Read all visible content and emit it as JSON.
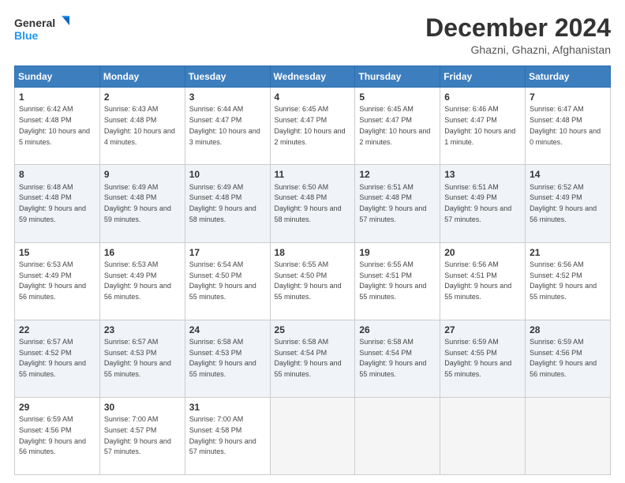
{
  "header": {
    "logo_line1": "General",
    "logo_line2": "Blue",
    "month": "December 2024",
    "location": "Ghazni, Ghazni, Afghanistan"
  },
  "days_of_week": [
    "Sunday",
    "Monday",
    "Tuesday",
    "Wednesday",
    "Thursday",
    "Friday",
    "Saturday"
  ],
  "weeks": [
    [
      {
        "day": "1",
        "sunrise": "6:42 AM",
        "sunset": "4:48 PM",
        "daylight": "10 hours and 5 minutes."
      },
      {
        "day": "2",
        "sunrise": "6:43 AM",
        "sunset": "4:48 PM",
        "daylight": "10 hours and 4 minutes."
      },
      {
        "day": "3",
        "sunrise": "6:44 AM",
        "sunset": "4:47 PM",
        "daylight": "10 hours and 3 minutes."
      },
      {
        "day": "4",
        "sunrise": "6:45 AM",
        "sunset": "4:47 PM",
        "daylight": "10 hours and 2 minutes."
      },
      {
        "day": "5",
        "sunrise": "6:45 AM",
        "sunset": "4:47 PM",
        "daylight": "10 hours and 2 minutes."
      },
      {
        "day": "6",
        "sunrise": "6:46 AM",
        "sunset": "4:47 PM",
        "daylight": "10 hours and 1 minute."
      },
      {
        "day": "7",
        "sunrise": "6:47 AM",
        "sunset": "4:48 PM",
        "daylight": "10 hours and 0 minutes."
      }
    ],
    [
      {
        "day": "8",
        "sunrise": "6:48 AM",
        "sunset": "4:48 PM",
        "daylight": "9 hours and 59 minutes."
      },
      {
        "day": "9",
        "sunrise": "6:49 AM",
        "sunset": "4:48 PM",
        "daylight": "9 hours and 59 minutes."
      },
      {
        "day": "10",
        "sunrise": "6:49 AM",
        "sunset": "4:48 PM",
        "daylight": "9 hours and 58 minutes."
      },
      {
        "day": "11",
        "sunrise": "6:50 AM",
        "sunset": "4:48 PM",
        "daylight": "9 hours and 58 minutes."
      },
      {
        "day": "12",
        "sunrise": "6:51 AM",
        "sunset": "4:48 PM",
        "daylight": "9 hours and 57 minutes."
      },
      {
        "day": "13",
        "sunrise": "6:51 AM",
        "sunset": "4:49 PM",
        "daylight": "9 hours and 57 minutes."
      },
      {
        "day": "14",
        "sunrise": "6:52 AM",
        "sunset": "4:49 PM",
        "daylight": "9 hours and 56 minutes."
      }
    ],
    [
      {
        "day": "15",
        "sunrise": "6:53 AM",
        "sunset": "4:49 PM",
        "daylight": "9 hours and 56 minutes."
      },
      {
        "day": "16",
        "sunrise": "6:53 AM",
        "sunset": "4:49 PM",
        "daylight": "9 hours and 56 minutes."
      },
      {
        "day": "17",
        "sunrise": "6:54 AM",
        "sunset": "4:50 PM",
        "daylight": "9 hours and 55 minutes."
      },
      {
        "day": "18",
        "sunrise": "6:55 AM",
        "sunset": "4:50 PM",
        "daylight": "9 hours and 55 minutes."
      },
      {
        "day": "19",
        "sunrise": "6:55 AM",
        "sunset": "4:51 PM",
        "daylight": "9 hours and 55 minutes."
      },
      {
        "day": "20",
        "sunrise": "6:56 AM",
        "sunset": "4:51 PM",
        "daylight": "9 hours and 55 minutes."
      },
      {
        "day": "21",
        "sunrise": "6:56 AM",
        "sunset": "4:52 PM",
        "daylight": "9 hours and 55 minutes."
      }
    ],
    [
      {
        "day": "22",
        "sunrise": "6:57 AM",
        "sunset": "4:52 PM",
        "daylight": "9 hours and 55 minutes."
      },
      {
        "day": "23",
        "sunrise": "6:57 AM",
        "sunset": "4:53 PM",
        "daylight": "9 hours and 55 minutes."
      },
      {
        "day": "24",
        "sunrise": "6:58 AM",
        "sunset": "4:53 PM",
        "daylight": "9 hours and 55 minutes."
      },
      {
        "day": "25",
        "sunrise": "6:58 AM",
        "sunset": "4:54 PM",
        "daylight": "9 hours and 55 minutes."
      },
      {
        "day": "26",
        "sunrise": "6:58 AM",
        "sunset": "4:54 PM",
        "daylight": "9 hours and 55 minutes."
      },
      {
        "day": "27",
        "sunrise": "6:59 AM",
        "sunset": "4:55 PM",
        "daylight": "9 hours and 55 minutes."
      },
      {
        "day": "28",
        "sunrise": "6:59 AM",
        "sunset": "4:56 PM",
        "daylight": "9 hours and 56 minutes."
      }
    ],
    [
      {
        "day": "29",
        "sunrise": "6:59 AM",
        "sunset": "4:56 PM",
        "daylight": "9 hours and 56 minutes."
      },
      {
        "day": "30",
        "sunrise": "7:00 AM",
        "sunset": "4:57 PM",
        "daylight": "9 hours and 57 minutes."
      },
      {
        "day": "31",
        "sunrise": "7:00 AM",
        "sunset": "4:58 PM",
        "daylight": "9 hours and 57 minutes."
      },
      null,
      null,
      null,
      null
    ]
  ],
  "labels": {
    "sunrise": "Sunrise:",
    "sunset": "Sunset:",
    "daylight": "Daylight:"
  }
}
